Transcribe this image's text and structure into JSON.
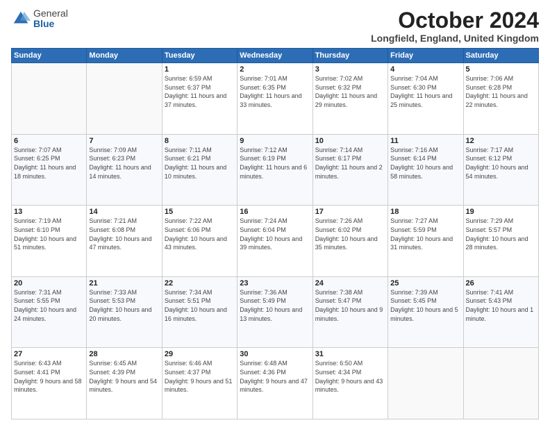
{
  "logo": {
    "general": "General",
    "blue": "Blue"
  },
  "header": {
    "month": "October 2024",
    "location": "Longfield, England, United Kingdom"
  },
  "weekdays": [
    "Sunday",
    "Monday",
    "Tuesday",
    "Wednesday",
    "Thursday",
    "Friday",
    "Saturday"
  ],
  "weeks": [
    [
      {
        "day": "",
        "info": ""
      },
      {
        "day": "",
        "info": ""
      },
      {
        "day": "1",
        "info": "Sunrise: 6:59 AM\nSunset: 6:37 PM\nDaylight: 11 hours and 37 minutes."
      },
      {
        "day": "2",
        "info": "Sunrise: 7:01 AM\nSunset: 6:35 PM\nDaylight: 11 hours and 33 minutes."
      },
      {
        "day": "3",
        "info": "Sunrise: 7:02 AM\nSunset: 6:32 PM\nDaylight: 11 hours and 29 minutes."
      },
      {
        "day": "4",
        "info": "Sunrise: 7:04 AM\nSunset: 6:30 PM\nDaylight: 11 hours and 25 minutes."
      },
      {
        "day": "5",
        "info": "Sunrise: 7:06 AM\nSunset: 6:28 PM\nDaylight: 11 hours and 22 minutes."
      }
    ],
    [
      {
        "day": "6",
        "info": "Sunrise: 7:07 AM\nSunset: 6:25 PM\nDaylight: 11 hours and 18 minutes."
      },
      {
        "day": "7",
        "info": "Sunrise: 7:09 AM\nSunset: 6:23 PM\nDaylight: 11 hours and 14 minutes."
      },
      {
        "day": "8",
        "info": "Sunrise: 7:11 AM\nSunset: 6:21 PM\nDaylight: 11 hours and 10 minutes."
      },
      {
        "day": "9",
        "info": "Sunrise: 7:12 AM\nSunset: 6:19 PM\nDaylight: 11 hours and 6 minutes."
      },
      {
        "day": "10",
        "info": "Sunrise: 7:14 AM\nSunset: 6:17 PM\nDaylight: 11 hours and 2 minutes."
      },
      {
        "day": "11",
        "info": "Sunrise: 7:16 AM\nSunset: 6:14 PM\nDaylight: 10 hours and 58 minutes."
      },
      {
        "day": "12",
        "info": "Sunrise: 7:17 AM\nSunset: 6:12 PM\nDaylight: 10 hours and 54 minutes."
      }
    ],
    [
      {
        "day": "13",
        "info": "Sunrise: 7:19 AM\nSunset: 6:10 PM\nDaylight: 10 hours and 51 minutes."
      },
      {
        "day": "14",
        "info": "Sunrise: 7:21 AM\nSunset: 6:08 PM\nDaylight: 10 hours and 47 minutes."
      },
      {
        "day": "15",
        "info": "Sunrise: 7:22 AM\nSunset: 6:06 PM\nDaylight: 10 hours and 43 minutes."
      },
      {
        "day": "16",
        "info": "Sunrise: 7:24 AM\nSunset: 6:04 PM\nDaylight: 10 hours and 39 minutes."
      },
      {
        "day": "17",
        "info": "Sunrise: 7:26 AM\nSunset: 6:02 PM\nDaylight: 10 hours and 35 minutes."
      },
      {
        "day": "18",
        "info": "Sunrise: 7:27 AM\nSunset: 5:59 PM\nDaylight: 10 hours and 31 minutes."
      },
      {
        "day": "19",
        "info": "Sunrise: 7:29 AM\nSunset: 5:57 PM\nDaylight: 10 hours and 28 minutes."
      }
    ],
    [
      {
        "day": "20",
        "info": "Sunrise: 7:31 AM\nSunset: 5:55 PM\nDaylight: 10 hours and 24 minutes."
      },
      {
        "day": "21",
        "info": "Sunrise: 7:33 AM\nSunset: 5:53 PM\nDaylight: 10 hours and 20 minutes."
      },
      {
        "day": "22",
        "info": "Sunrise: 7:34 AM\nSunset: 5:51 PM\nDaylight: 10 hours and 16 minutes."
      },
      {
        "day": "23",
        "info": "Sunrise: 7:36 AM\nSunset: 5:49 PM\nDaylight: 10 hours and 13 minutes."
      },
      {
        "day": "24",
        "info": "Sunrise: 7:38 AM\nSunset: 5:47 PM\nDaylight: 10 hours and 9 minutes."
      },
      {
        "day": "25",
        "info": "Sunrise: 7:39 AM\nSunset: 5:45 PM\nDaylight: 10 hours and 5 minutes."
      },
      {
        "day": "26",
        "info": "Sunrise: 7:41 AM\nSunset: 5:43 PM\nDaylight: 10 hours and 1 minute."
      }
    ],
    [
      {
        "day": "27",
        "info": "Sunrise: 6:43 AM\nSunset: 4:41 PM\nDaylight: 9 hours and 58 minutes."
      },
      {
        "day": "28",
        "info": "Sunrise: 6:45 AM\nSunset: 4:39 PM\nDaylight: 9 hours and 54 minutes."
      },
      {
        "day": "29",
        "info": "Sunrise: 6:46 AM\nSunset: 4:37 PM\nDaylight: 9 hours and 51 minutes."
      },
      {
        "day": "30",
        "info": "Sunrise: 6:48 AM\nSunset: 4:36 PM\nDaylight: 9 hours and 47 minutes."
      },
      {
        "day": "31",
        "info": "Sunrise: 6:50 AM\nSunset: 4:34 PM\nDaylight: 9 hours and 43 minutes."
      },
      {
        "day": "",
        "info": ""
      },
      {
        "day": "",
        "info": ""
      }
    ]
  ]
}
